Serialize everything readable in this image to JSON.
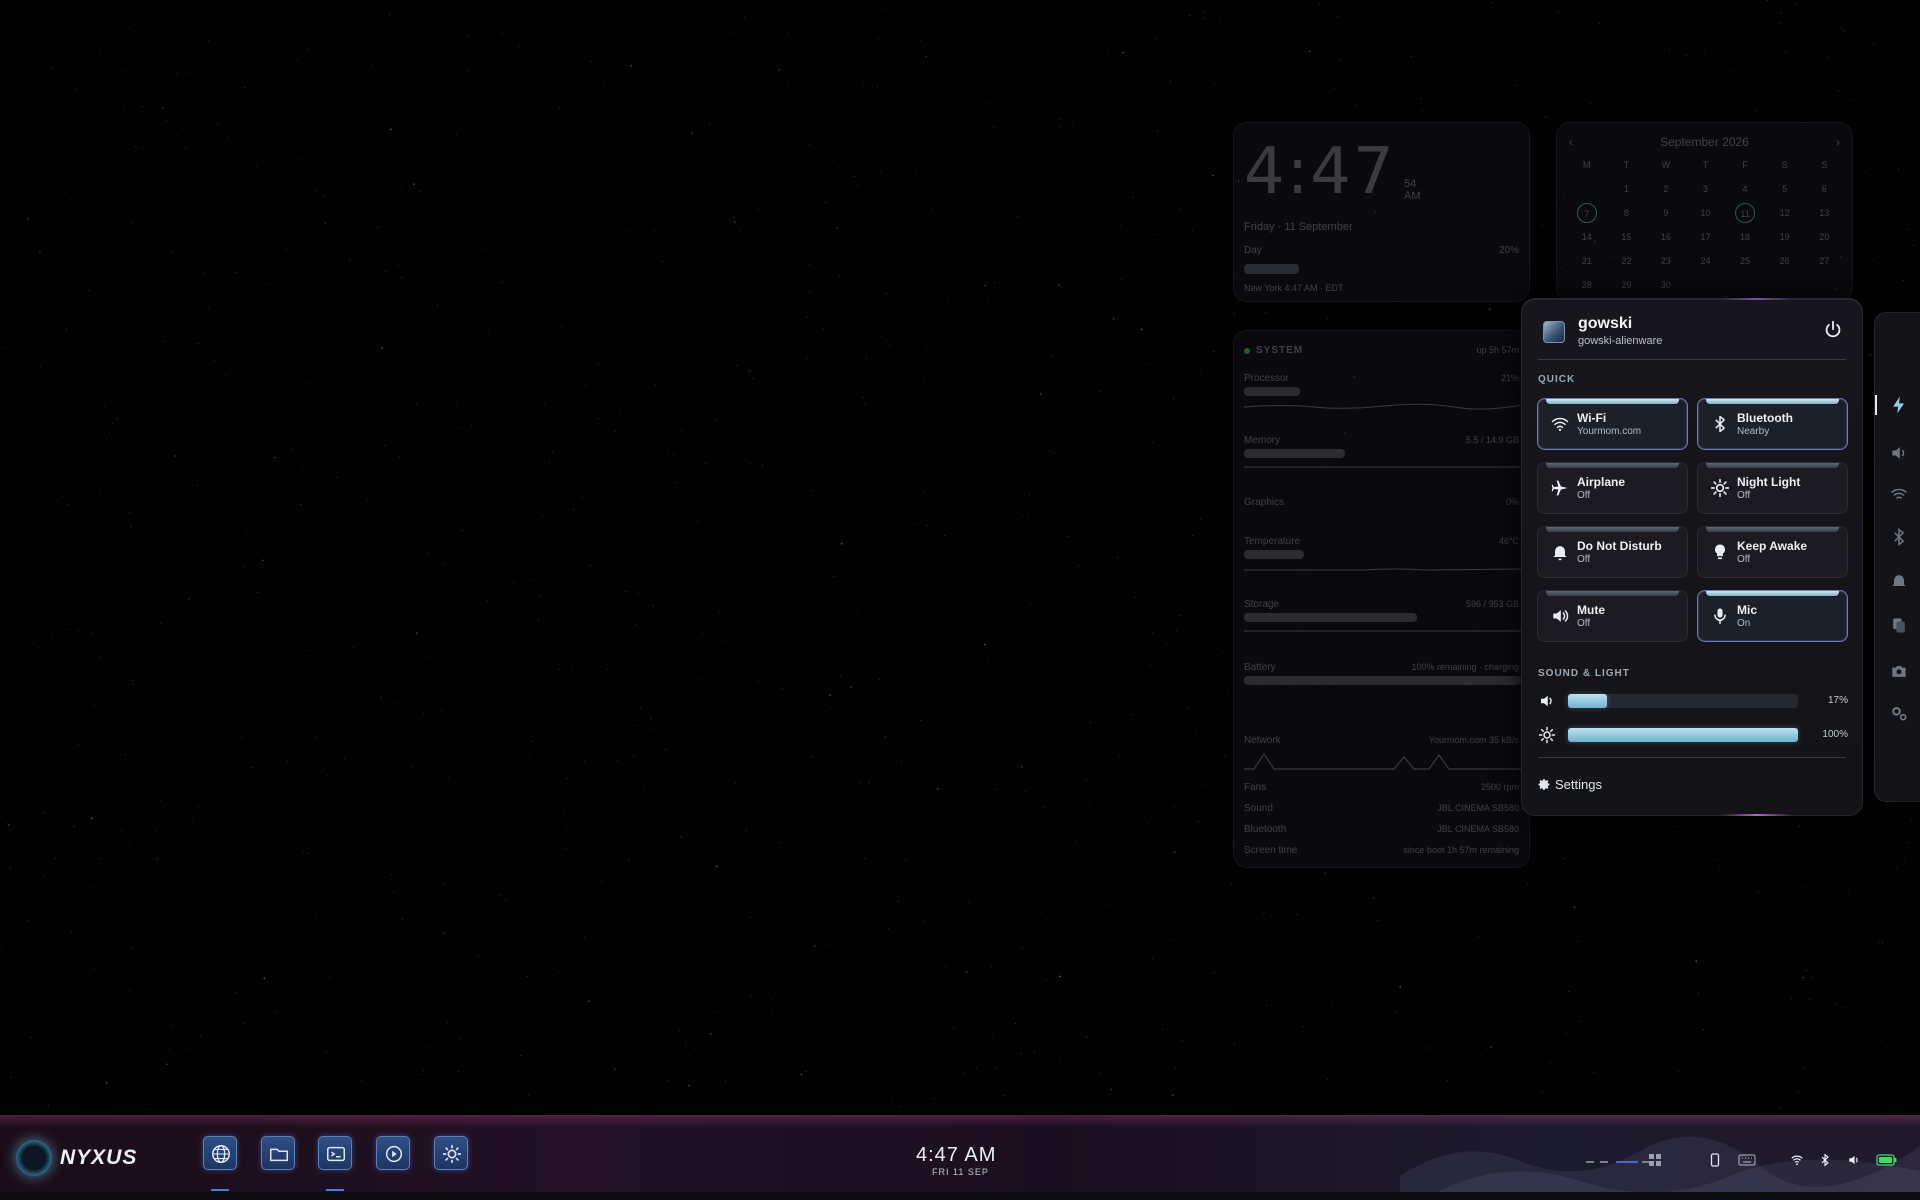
{
  "clock_widget": {
    "time": "4:47",
    "seconds": "54",
    "ampm": "AM",
    "date": "Friday · 11 September",
    "day_label": "Day",
    "day_percent": "20%",
    "timezone": "New York 4:47 AM · EDT"
  },
  "calendar_widget": {
    "month": "September 2026",
    "prev": "‹",
    "next": "›",
    "weekdays": [
      "M",
      "T",
      "W",
      "T",
      "F",
      "S",
      "S"
    ],
    "days": [
      "",
      "1",
      "2",
      "3",
      "4",
      "5",
      "6",
      "7",
      "8",
      "9",
      "10",
      "11",
      "12",
      "13",
      "14",
      "15",
      "16",
      "17",
      "18",
      "19",
      "20",
      "21",
      "22",
      "23",
      "24",
      "25",
      "26",
      "27",
      "28",
      "29",
      "30",
      "",
      "",
      "",
      ""
    ]
  },
  "system_widget": {
    "title": "SYSTEM",
    "uptime": "up 5h 57m",
    "processor": {
      "label": "Processor",
      "value": "21%"
    },
    "memory": {
      "label": "Memory",
      "value": "5.5 / 14.9 GB"
    },
    "graphics": {
      "label": "Graphics",
      "value": "0%"
    },
    "temperature": {
      "label": "Temperature",
      "value": "46°C"
    },
    "storage": {
      "label": "Storage",
      "value": "596 / 953 GB"
    },
    "battery": {
      "label": "Battery",
      "value": "100% remaining · charging"
    },
    "network": {
      "label": "Network",
      "ssid": "Yourmom.com",
      "value": "35 kB/s"
    },
    "fans": {
      "label": "Fans",
      "value": "2500 rpm"
    },
    "sound": {
      "label": "Sound",
      "value": "JBL CINEMA SB580"
    },
    "bluetooth": {
      "label": "Bluetooth",
      "value": "JBL CINEMA SB580"
    },
    "screen_time": {
      "label": "Screen time",
      "value": "since boot 1h 57m remaining"
    }
  },
  "quick_settings": {
    "user": "gowski",
    "host": "gowski-alienware",
    "quick_label": "QUICK",
    "tiles": [
      {
        "name": "Wi-Fi",
        "status": "Yourmom.com",
        "on": true
      },
      {
        "name": "Bluetooth",
        "status": "Nearby",
        "on": true
      },
      {
        "name": "Airplane",
        "status": "Off",
        "on": false
      },
      {
        "name": "Night Light",
        "status": "Off",
        "on": false
      },
      {
        "name": "Do Not Disturb",
        "status": "Off",
        "on": false
      },
      {
        "name": "Keep Awake",
        "status": "Off",
        "on": false
      },
      {
        "name": "Mute",
        "status": "Off",
        "on": false
      },
      {
        "name": "Mic",
        "status": "On",
        "on": true
      }
    ],
    "sound_light_label": "SOUND & LIGHT",
    "volume": {
      "value": 17,
      "label": "17%"
    },
    "brightness": {
      "value": 100,
      "label": "100%"
    },
    "settings_label": "Settings"
  },
  "side_rail": {
    "icons": [
      "bolt-icon",
      "volume-icon",
      "wifi-icon",
      "bluetooth-icon",
      "bell-icon",
      "clipboard-icon",
      "camera-icon",
      "gears-icon"
    ],
    "active": 0
  },
  "taskbar": {
    "brand": "NYXUS",
    "apps": [
      "browser-icon",
      "files-icon",
      "terminal-icon",
      "media-player-icon",
      "settings-sun-icon"
    ],
    "time": "4:47 AM",
    "date": "FRI 11 SEP",
    "colors": {
      "accent": "#4a7bd6",
      "battery": "#3ddc6a"
    }
  }
}
